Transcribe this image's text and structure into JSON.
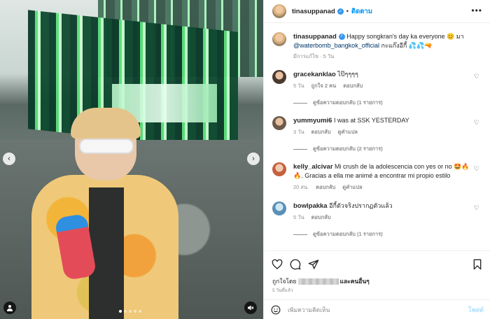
{
  "media": {
    "dots_count": 5,
    "active_dot": 0
  },
  "header": {
    "username": "tinasuppanad",
    "separator": "•",
    "follow_label": "ติดตาม",
    "more_glyph": "•••"
  },
  "caption": {
    "username": "tinasuppanad",
    "text_before": "Happy songkran's day ka everyone 😊 มา ",
    "mention": "@waterbomb_bangkok_official",
    "text_after": " กะแก๊งอีกี้ 💦💦🔫",
    "meta": "มีการแก้ไข · 5 วัน"
  },
  "comments": [
    {
      "username": "gracekanklao",
      "text": "ไป๊ๆๆๆๆ",
      "time": "5 วัน",
      "likes": "ถูกใจ 2 คน",
      "reply": "ตอบกลับ",
      "translate": "",
      "replies": "ดูข้อความตอบกลับ (1 รายการ)"
    },
    {
      "username": "yummyumi6",
      "text": "I was at SSK YESTERDAY",
      "time": "3 วัน",
      "likes": "",
      "reply": "ตอบกลับ",
      "translate": "ดูคำแปล",
      "replies": "ดูข้อความตอบกลับ (2 รายการ)"
    },
    {
      "username": "kelly_alcivar",
      "text": "Mi crush de la adolescencia con yes or no 🤩🔥🔥. Gracias a ella me animé a encontrar mi propio estilo",
      "time": "20 สน.",
      "likes": "",
      "reply": "ตอบกลับ",
      "translate": "ดูคำแปล",
      "replies": ""
    },
    {
      "username": "bowlpakka",
      "text": "อีกี้ตัวจริงปรากฏตัวแล้ว",
      "time": "5 วัน",
      "likes": "",
      "reply": "ตอบกลับ",
      "translate": "",
      "replies": "ดูข้อความตอบกลับ (1 รายการ)"
    }
  ],
  "likes": {
    "prefix": "ถูกใจโดย",
    "suffix": "และคนอื่นๆ"
  },
  "time_ago": "5 วันที่แล้ว",
  "comment_box": {
    "placeholder": "เพิ่มความคิดเห็น",
    "post_label": "โพสต์"
  },
  "colors": {
    "accent": "#0095f6",
    "verified": "#3897f0",
    "post_disabled": "#b2dffc",
    "muted": "#8e8e8e"
  }
}
